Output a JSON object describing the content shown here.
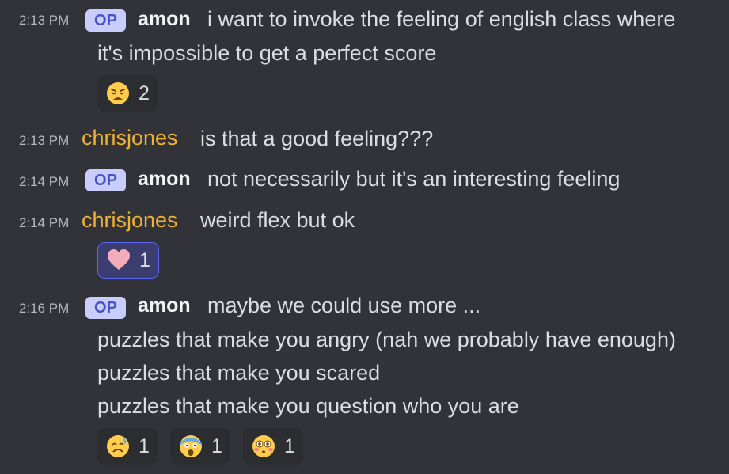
{
  "messages": [
    {
      "time": "2:13 PM",
      "badge": "OP",
      "user": "amon",
      "text": "i want to invoke the feeling of english class where",
      "continuation": "it's impossible to get a perfect score",
      "reactions": [
        {
          "emoji": "weary-face",
          "count": "2"
        }
      ]
    },
    {
      "time": "2:13 PM",
      "user": "chrisjones",
      "text": "is that a good feeling???"
    },
    {
      "time": "2:14 PM",
      "badge": "OP",
      "user": "amon",
      "text": "not necessarily but it's an interesting feeling"
    },
    {
      "time": "2:14 PM",
      "user": "chrisjones",
      "text": "weird flex but ok",
      "reactions": [
        {
          "emoji": "pink-heart",
          "count": "1"
        }
      ]
    },
    {
      "time": "2:16 PM",
      "badge": "OP",
      "user": "amon",
      "text": "maybe we could use more ...",
      "lines": [
        "puzzles that make you angry (nah we probably have enough)",
        "puzzles that make you scared",
        "puzzles that make you question who you are"
      ],
      "reactions": [
        {
          "emoji": "anxious-face",
          "count": "1"
        },
        {
          "emoji": "screaming-face",
          "count": "1"
        },
        {
          "emoji": "flushed-face",
          "count": "1"
        }
      ]
    }
  ],
  "colors": {
    "background": "#313338",
    "username_chrisjones": "#f0b232",
    "op_badge_bg": "#c9cdfb",
    "op_badge_text": "#4752c4",
    "reaction_active_border": "#5865f2"
  }
}
